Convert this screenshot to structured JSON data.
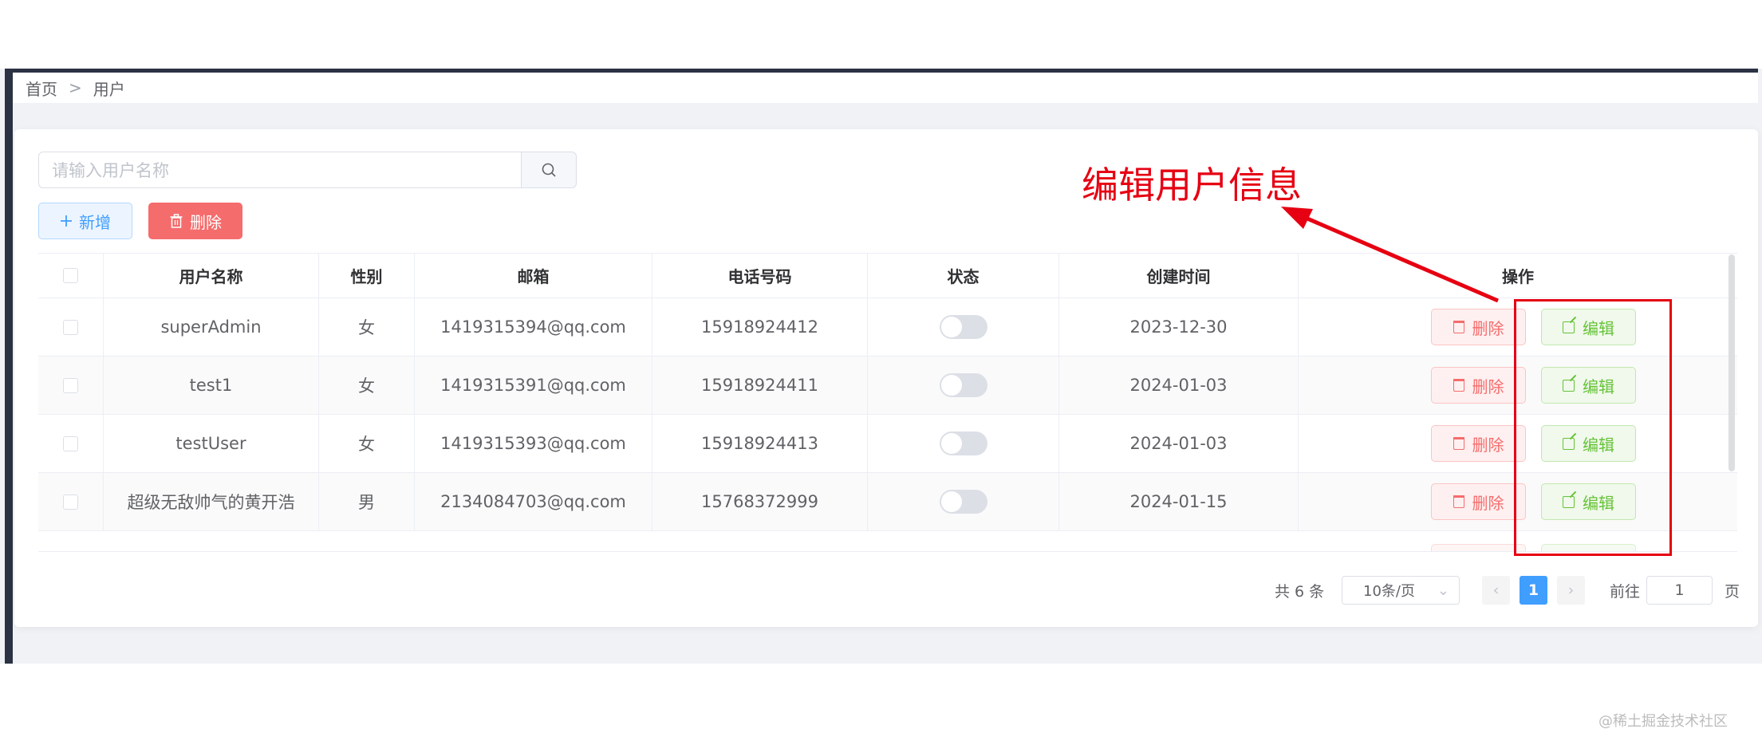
{
  "breadcrumb": {
    "home": "首页",
    "separator": ">",
    "current": "用户"
  },
  "search": {
    "placeholder": "请输入用户名称",
    "button_icon": "search-icon"
  },
  "toolbar": {
    "add_label": "新增",
    "add_icon": "plus-icon",
    "delete_label": "删除",
    "delete_icon": "trash-icon"
  },
  "table": {
    "columns": [
      "用户名称",
      "性别",
      "邮箱",
      "电话号码",
      "状态",
      "创建时间",
      "操作"
    ],
    "rows": [
      {
        "name": "superAdmin",
        "gender": "女",
        "email": "1419315394@qq.com",
        "phone": "15918924412",
        "status": false,
        "created": "2023-12-30"
      },
      {
        "name": "test1",
        "gender": "女",
        "email": "1419315391@qq.com",
        "phone": "15918924411",
        "status": false,
        "created": "2024-01-03"
      },
      {
        "name": "testUser",
        "gender": "女",
        "email": "1419315393@qq.com",
        "phone": "15918924413",
        "status": false,
        "created": "2024-01-03"
      },
      {
        "name": "超级无敌帅气的黄开浩",
        "gender": "男",
        "email": "2134084703@qq.com",
        "phone": "15768372999",
        "status": false,
        "created": "2024-01-15"
      }
    ],
    "row_delete_label": "删除",
    "row_edit_label": "编辑"
  },
  "pagination": {
    "total": "共 6 条",
    "page_size": "10条/页",
    "current_page": "1",
    "goto_label": "前往",
    "goto_value": "1",
    "page_suffix": "页"
  },
  "annotation": {
    "text": "编辑用户信息",
    "color": "#e60012"
  },
  "watermark": "@稀土掘金技术社区",
  "colors": {
    "primary": "#409eff",
    "danger": "#f56c6c",
    "success": "#67c23a",
    "sidebar": "#2b3243"
  }
}
